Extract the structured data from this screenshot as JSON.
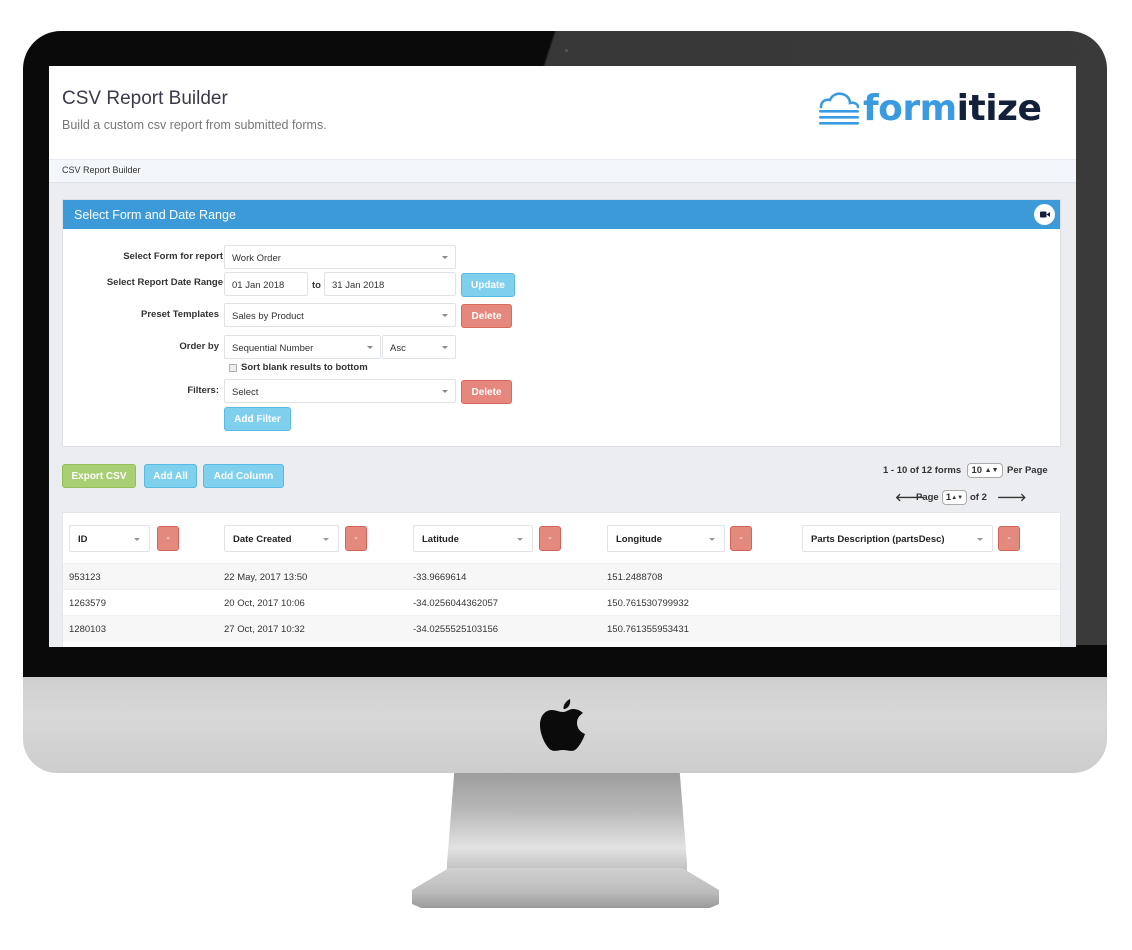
{
  "header": {
    "title": "CSV Report Builder",
    "subtitle": "Build a custom csv report from submitted forms.",
    "logo": {
      "part1": "form",
      "part2": "itize",
      "brand_color": "#3b9be0",
      "dark_color": "#13203a"
    }
  },
  "breadcrumb": "CSV Report Builder",
  "panel": {
    "title": "Select Form and Date Range",
    "video_icon": "video-camera-icon",
    "form_label": "Select Form for report",
    "form_value": "Work Order",
    "date_label": "Select Report Date Range",
    "date_from": "01 Jan 2018",
    "to_label": "to",
    "date_to": "31 Jan 2018",
    "update_label": "Update",
    "preset_label": "Preset Templates",
    "preset_value": "Sales by Product",
    "preset_delete_label": "Delete",
    "order_label": "Order by",
    "order_field": "Sequential Number",
    "order_dir": "Asc",
    "sort_blank_label": "Sort blank results to bottom",
    "sort_blank_checked": false,
    "filters_label": "Filters:",
    "filter_value": "Select",
    "filter_delete_label": "Delete",
    "add_filter_label": "Add Filter"
  },
  "actions": {
    "export_label": "Export CSV",
    "add_all_label": "Add All",
    "add_column_label": "Add Column"
  },
  "pagination": {
    "range_text": "1 - 10 of 12 forms",
    "per_page_value": "10",
    "per_page_label": "Per Page",
    "page_label": "Page",
    "page_value": "1",
    "of_label": "of 2",
    "prev_icon": "arrow-left-icon",
    "next_icon": "arrow-right-icon"
  },
  "table": {
    "remove_label": "-",
    "columns": [
      "ID",
      "Date Created",
      "Latitude",
      "Longitude",
      "Parts Description (partsDesc)"
    ],
    "rows": [
      [
        "953123",
        "22 May, 2017 13:50",
        "-33.9669614",
        "151.2488708",
        ""
      ],
      [
        "1263579",
        "20 Oct, 2017 10:06",
        "-34.0256044362057",
        "150.761530799932",
        ""
      ],
      [
        "1280103",
        "27 Oct, 2017 10:32",
        "-34.0255525103156",
        "150.761355953431",
        ""
      ]
    ]
  },
  "colors": {
    "panel_header": "#3d9ad8",
    "info_button": "#7fd0ec",
    "danger_button": "#e5877c",
    "success_button": "#a9cf74"
  }
}
